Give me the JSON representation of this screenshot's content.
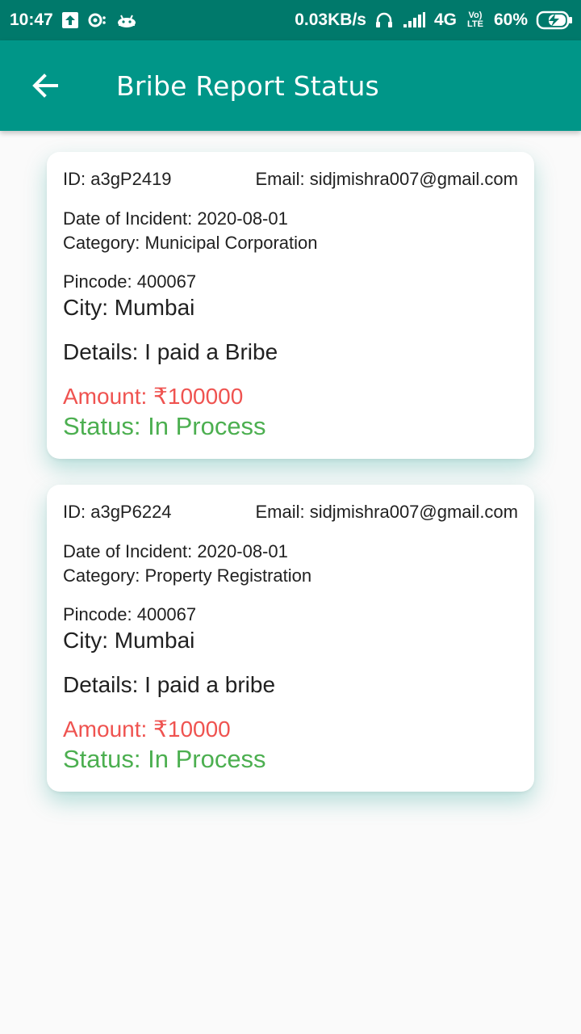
{
  "status_bar": {
    "time": "10:47",
    "net_speed": "0.03KB/s",
    "network": "4G",
    "volte": "Vo) LTE",
    "battery": "60%"
  },
  "app_bar": {
    "title": "Bribe Report Status"
  },
  "reports": [
    {
      "id": "ID: a3gP2419",
      "email": "Email: sidjmishra007@gmail.com",
      "date": "Date of Incident: 2020-08-01",
      "category": "Category: Municipal Corporation",
      "pincode": "Pincode: 400067",
      "city": "City: Mumbai",
      "details": "Details: I paid a Bribe",
      "amount": "Amount: ₹100000",
      "status": "Status: In Process"
    },
    {
      "id": "ID: a3gP6224",
      "email": "Email: sidjmishra007@gmail.com",
      "date": "Date of Incident: 2020-08-01",
      "category": "Category: Property Registration",
      "pincode": "Pincode: 400067",
      "city": "City: Mumbai",
      "details": "Details: I paid a bribe",
      "amount": "Amount: ₹10000",
      "status": "Status: In Process"
    }
  ],
  "colors": {
    "status_bar": "#00796b",
    "app_bar": "#009688",
    "amount": "#ef5350",
    "status": "#4caf50",
    "background": "#fafafa"
  }
}
